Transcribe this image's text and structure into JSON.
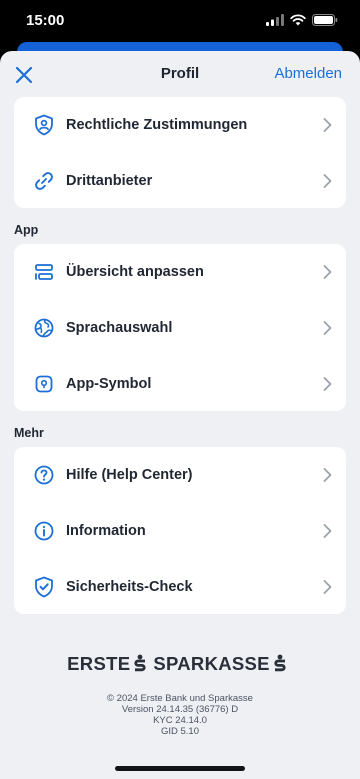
{
  "status_bar": {
    "time": "15:00"
  },
  "nav": {
    "title": "Profil",
    "logout_label": "Abmelden"
  },
  "card_top": {
    "items": [
      {
        "label": "Rechtliche Zustimmungen",
        "icon": "shield-user-icon"
      },
      {
        "label": "Drittanbieter",
        "icon": "link-icon"
      }
    ]
  },
  "section_app": {
    "title": "App",
    "items": [
      {
        "label": "Übersicht anpassen",
        "icon": "layout-icon"
      },
      {
        "label": "Sprachauswahl",
        "icon": "globe-icon"
      },
      {
        "label": "App-Symbol",
        "icon": "app-symbol-icon"
      }
    ]
  },
  "section_more": {
    "title": "Mehr",
    "items": [
      {
        "label": "Hilfe (Help Center)",
        "icon": "help-icon"
      },
      {
        "label": "Information",
        "icon": "info-icon"
      },
      {
        "label": "Sicherheits-Check",
        "icon": "shield-check-icon"
      }
    ]
  },
  "footer": {
    "brand_left": "ERSTE",
    "brand_right": "SPARKASSE",
    "copyright": "© 2024 Erste Bank und Sparkasse",
    "version": "Version 24.14.35 (36776) D",
    "kyc": "KYC 24.14.0",
    "gid": "GID 5.10"
  },
  "colors": {
    "accent": "#1c6fd6",
    "background": "#eef0f4",
    "card": "#ffffff",
    "text": "#1f2733"
  }
}
